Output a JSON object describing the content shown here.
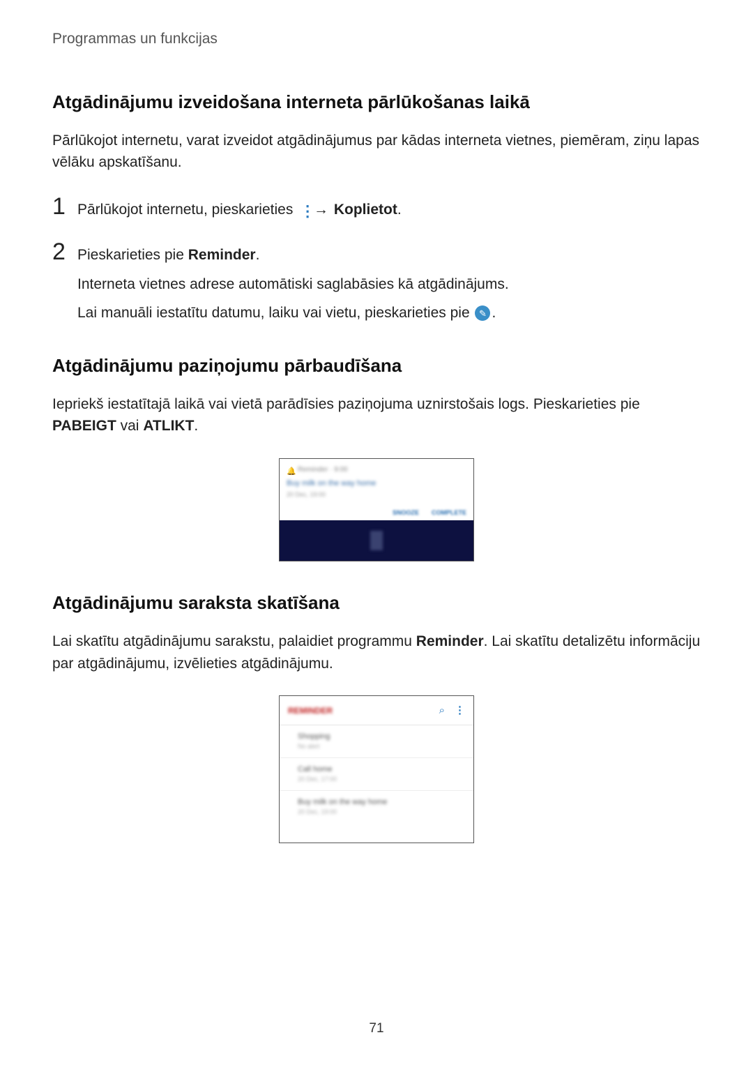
{
  "breadcrumb": "Programmas un funkcijas",
  "section1": {
    "heading": "Atgādinājumu izveidošana interneta pārlūkošanas laikā",
    "intro": "Pārlūkojot internetu, varat izveidot atgādinājumus par kādas interneta vietnes, piemēram, ziņu lapas vēlāku apskatīšanu.",
    "step1_pre": "Pārlūkojot internetu, pieskarieties ",
    "step1_arrow": "→",
    "step1_bold": "Koplietot",
    "step1_post": ".",
    "step2_pre": "Pieskarieties pie ",
    "step2_bold": "Reminder",
    "step2_post": ".",
    "step2_sub1": "Interneta vietnes adrese automātiski saglabāsies kā atgādinājums.",
    "step2_sub2_pre": "Lai manuāli iestatītu datumu, laiku vai vietu, pieskarieties pie ",
    "step2_sub2_post": "."
  },
  "section2": {
    "heading": "Atgādinājumu paziņojumu pārbaudīšana",
    "para_pre": "Iepriekš iestatītajā laikā vai vietā parādīsies paziņojuma uznirstošais logs. Pieskarieties pie ",
    "bold1": "PABEIGT",
    "mid": " vai ",
    "bold2": "ATLIKT",
    "post": "."
  },
  "fig1": {
    "status": "Reminder · 9:00",
    "line1": "Buy milk on the way home",
    "line2": "20 Dec, 19:00",
    "action1": "SNOOZE",
    "action2": "COMPLETE"
  },
  "section3": {
    "heading": "Atgādinājumu saraksta skatīšana",
    "para_pre": "Lai skatītu atgādinājumu sarakstu, palaidiet programmu ",
    "bold": "Reminder",
    "para_post": ". Lai skatītu detalizētu informāciju par atgādinājumu, izvēlieties atgādinājumu."
  },
  "fig2": {
    "title": "REMINDER",
    "items": [
      {
        "t": "Shopping",
        "s": "No alert"
      },
      {
        "t": "Call home",
        "s": "20 Dec, 17:00"
      },
      {
        "t": "Buy milk on the way home",
        "s": "20 Dec, 19:00"
      }
    ]
  },
  "page_number": "71"
}
